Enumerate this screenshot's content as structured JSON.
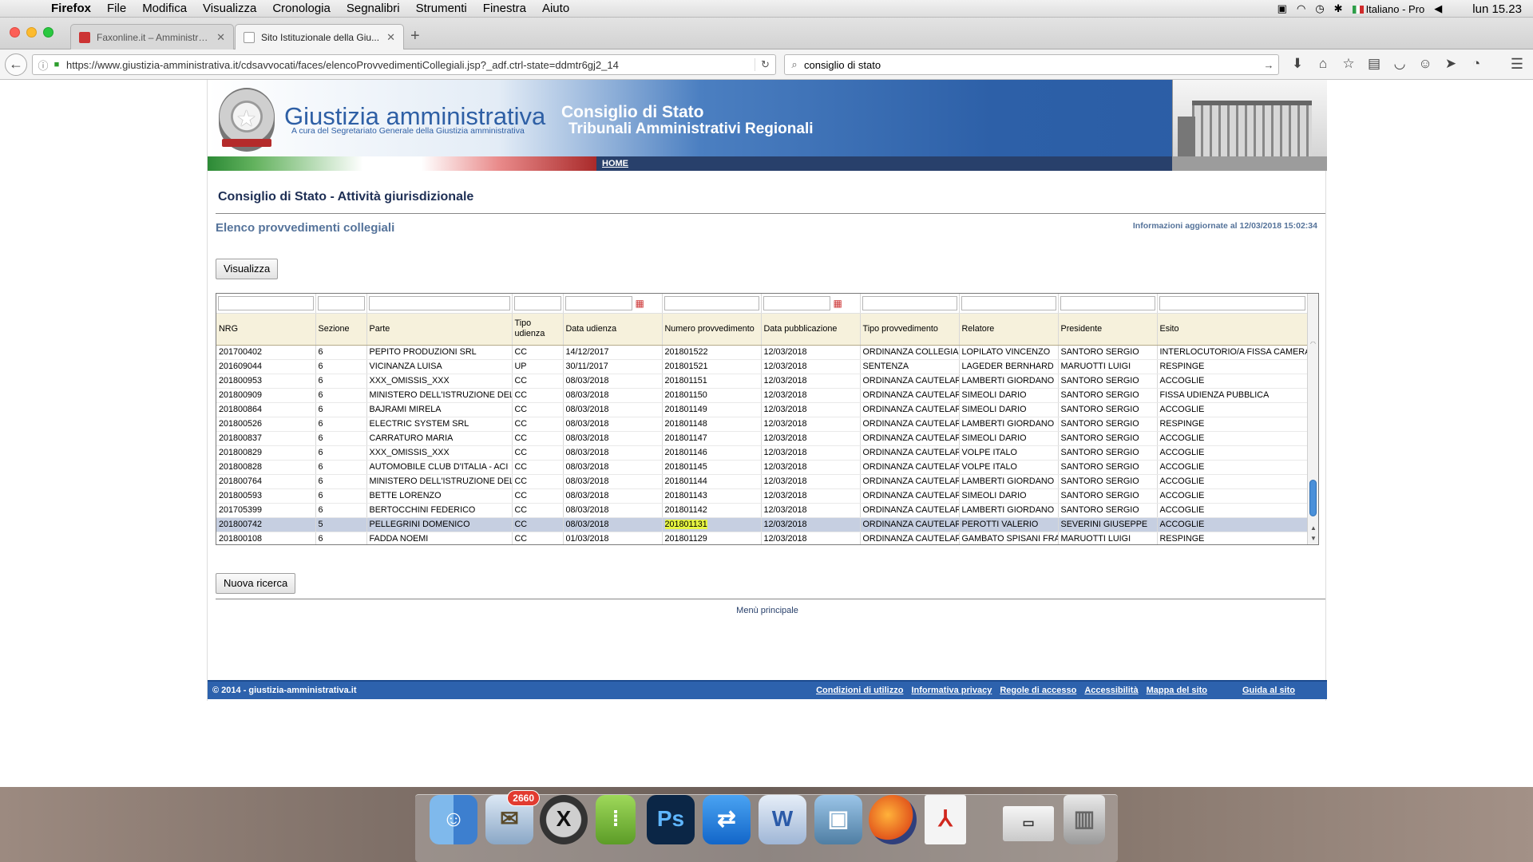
{
  "menubar": {
    "app": "Firefox",
    "items": [
      "File",
      "Modifica",
      "Visualizza",
      "Cronologia",
      "Segnalibri",
      "Strumenti",
      "Finestra",
      "Aiuto"
    ],
    "input_source": "Italiano - Pro",
    "clock": "lun 15.23"
  },
  "browser": {
    "tabs": [
      {
        "title": "Faxonline.it – Amministra..."
      },
      {
        "title": "Sito Istituzionale della Giu..."
      }
    ],
    "url_domain": "https://www.giustizia-amministrativa.it",
    "url_path": "/cdsavvocati/faces/elencoProvvedimentiCollegiali.jsp?_adf.ctrl-state=ddmtr6gj2_14",
    "search_value": "consiglio di stato"
  },
  "site": {
    "brand_title": "Giustizia amministrativa",
    "brand_subtitle": "A cura del Segretariato Generale della Giustizia amministrativa",
    "banner_line1": "Consiglio di Stato",
    "banner_line2": "Tribunali Amministrativi Regionali",
    "home_link": "HOME",
    "page_title": "Consiglio di Stato - Attività giurisdizionale",
    "subtitle": "Elenco provvedimenti collegiali",
    "updated": "Informazioni aggiornate al 12/03/2018 15:02:34",
    "btn_visualizza": "Visualizza",
    "btn_nuova": "Nuova ricerca",
    "main_menu": "Menù principale",
    "footer_copy": "© 2014 - giustizia-amministrativa.it",
    "footer_links": [
      "Condizioni di utilizzo",
      "Informativa privacy",
      "Regole di accesso",
      "Accessibilità",
      "Mappa del sito"
    ],
    "footer_guide": "Guida al sito"
  },
  "table": {
    "columns": [
      "NRG",
      "Sezione",
      "Parte",
      "Tipo udienza",
      "Data udienza",
      "Numero provvedimento",
      "Data pubblicazione",
      "Tipo provvedimento",
      "Relatore",
      "Presidente",
      "Esito"
    ],
    "rows": [
      [
        "201700402",
        "6",
        "PEPITO PRODUZIONI SRL",
        "CC",
        "14/12/2017",
        "201801522",
        "12/03/2018",
        "ORDINANZA COLLEGIALE",
        "LOPILATO VINCENZO",
        "SANTORO SERGIO",
        "INTERLOCUTORIO/A FISSA CAMERA DI"
      ],
      [
        "201609044",
        "6",
        "VICINANZA LUISA",
        "UP",
        "30/11/2017",
        "201801521",
        "12/03/2018",
        "SENTENZA",
        "LAGEDER BERNHARD",
        "MARUOTTI LUIGI",
        "RESPINGE"
      ],
      [
        "201800953",
        "6",
        "XXX_OMISSIS_XXX",
        "CC",
        "08/03/2018",
        "201801151",
        "12/03/2018",
        "ORDINANZA CAUTELARE",
        "LAMBERTI GIORDANO",
        "SANTORO SERGIO",
        "ACCOGLIE"
      ],
      [
        "201800909",
        "6",
        "MINISTERO DELL'ISTRUZIONE DELL'",
        "CC",
        "08/03/2018",
        "201801150",
        "12/03/2018",
        "ORDINANZA CAUTELARE",
        "SIMEOLI DARIO",
        "SANTORO SERGIO",
        "FISSA UDIENZA PUBBLICA"
      ],
      [
        "201800864",
        "6",
        "BAJRAMI MIRELA",
        "CC",
        "08/03/2018",
        "201801149",
        "12/03/2018",
        "ORDINANZA CAUTELARE",
        "SIMEOLI DARIO",
        "SANTORO SERGIO",
        "ACCOGLIE"
      ],
      [
        "201800526",
        "6",
        "ELECTRIC SYSTEM SRL",
        "CC",
        "08/03/2018",
        "201801148",
        "12/03/2018",
        "ORDINANZA CAUTELARE",
        "LAMBERTI GIORDANO",
        "SANTORO SERGIO",
        "RESPINGE"
      ],
      [
        "201800837",
        "6",
        "CARRATURO MARIA",
        "CC",
        "08/03/2018",
        "201801147",
        "12/03/2018",
        "ORDINANZA CAUTELARE",
        "SIMEOLI DARIO",
        "SANTORO SERGIO",
        "ACCOGLIE"
      ],
      [
        "201800829",
        "6",
        "XXX_OMISSIS_XXX",
        "CC",
        "08/03/2018",
        "201801146",
        "12/03/2018",
        "ORDINANZA CAUTELARE",
        "VOLPE ITALO",
        "SANTORO SERGIO",
        "ACCOGLIE"
      ],
      [
        "201800828",
        "6",
        "AUTOMOBILE CLUB D'ITALIA - ACI",
        "CC",
        "08/03/2018",
        "201801145",
        "12/03/2018",
        "ORDINANZA CAUTELARE",
        "VOLPE ITALO",
        "SANTORO SERGIO",
        "ACCOGLIE"
      ],
      [
        "201800764",
        "6",
        "MINISTERO DELL'ISTRUZIONE DELL'",
        "CC",
        "08/03/2018",
        "201801144",
        "12/03/2018",
        "ORDINANZA CAUTELARE",
        "LAMBERTI GIORDANO",
        "SANTORO SERGIO",
        "ACCOGLIE"
      ],
      [
        "201800593",
        "6",
        "BETTE LORENZO",
        "CC",
        "08/03/2018",
        "201801143",
        "12/03/2018",
        "ORDINANZA CAUTELARE",
        "SIMEOLI DARIO",
        "SANTORO SERGIO",
        "ACCOGLIE"
      ],
      [
        "201705399",
        "6",
        "BERTOCCHINI FEDERICO",
        "CC",
        "08/03/2018",
        "201801142",
        "12/03/2018",
        "ORDINANZA CAUTELARE",
        "LAMBERTI GIORDANO",
        "SANTORO SERGIO",
        "ACCOGLIE"
      ],
      [
        "201800742",
        "5",
        "PELLEGRINI DOMENICO",
        "CC",
        "08/03/2018",
        "201801131",
        "12/03/2018",
        "ORDINANZA CAUTELARE",
        "PEROTTI VALERIO",
        "SEVERINI GIUSEPPE",
        "ACCOGLIE"
      ],
      [
        "201800108",
        "6",
        "FADDA NOEMI",
        "CC",
        "01/03/2018",
        "201801129",
        "12/03/2018",
        "ORDINANZA CAUTELARE",
        "GAMBATO SPISANI FRANCESCA",
        "MARUOTTI LUIGI",
        "RESPINGE"
      ]
    ],
    "selected_row": 12,
    "highlighted_cell": "201801131"
  },
  "dock": {
    "icons": [
      "finder-icon",
      "mail-icon",
      "xquartz-icon",
      "notes-icon",
      "photoshop-icon",
      "teamviewer-icon",
      "word-icon",
      "preview-icon",
      "firefox-icon",
      "acrobat-icon",
      "downloads-icon",
      "trash-icon"
    ],
    "mail_badge": "2660"
  },
  "colors": {
    "banner_blue": "#2d60a8",
    "title_navy": "#1e2f55",
    "subtitle_blue": "#55739a",
    "header_beige": "#f6f1dc",
    "selected_row": "#c6cfe1",
    "cell_highlight": "#e6f542"
  }
}
